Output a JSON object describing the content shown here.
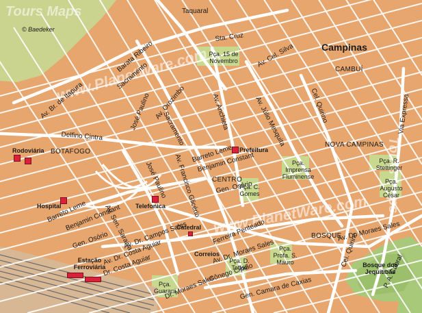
{
  "map": {
    "city": "Campinas",
    "credit": "© Baedeker",
    "watermarks": [
      "Tours Maps",
      "www.PlanetWare.com",
      "www.PlanetWare.com",
      "Tours Maps"
    ],
    "colors": {
      "land": "#e8a66f",
      "block": "#e8a66f",
      "street": "#ffffff",
      "park": "#a9c97a",
      "plaza": "#c9d88f",
      "marker": "#d9213a",
      "railway": "#6a6a6a"
    },
    "districts": [
      "CAMBUÍ",
      "BOTAFOGO",
      "CENTRO",
      "NOVA CAMPINAS",
      "BOSQUE"
    ],
    "streets": [
      "Taquaral",
      "Sta. Cruz",
      "Av. Cel. Silva",
      "Barata Ribeiro",
      "Sacramento",
      "Av. Br. de Itapura",
      "José Paulino",
      "Av. Orozimbo",
      "Av. Anchieta",
      "Av. Júlio Mesquita",
      "Cel. Quirino",
      "Via Expressa",
      "Delfino Cintra",
      "Barreto Leme",
      "Sacramento",
      "Benjamin Constant",
      "Gen. Osório",
      "Av. Francisco Glicério",
      "José Paulino",
      "Barreto Leme",
      "Benjamin Constant",
      "Av. Sen. Saraiva",
      "Av. Dr. Campos Sales",
      "Gen. Osório",
      "Ferreira Penteado",
      "Av. Dr. Moraes Sales",
      "Av. Dr. Moraes Sales",
      "Av. Dr. Costa Aguiar",
      "Dr. Costa Aguiar",
      "Cônego Cipião",
      "Gen. Camara de Caxias",
      "Cel. Quirino",
      "P. A. Cabral",
      "Dr. Moraes Sales"
    ],
    "places": [
      "Pça. 15 de Novembro",
      "Pça. Imprensa Fluminense",
      "Pça. C. Gomes",
      "Pça. R. Stettinger",
      "Pça. Augusto César",
      "Pça. Profa. S. Mauro",
      "Pça. D. Toffoli",
      "Pça. Guarani",
      "Bosque dos Jequitibás"
    ],
    "pois": [
      "Prefeitura",
      "Rodoviária",
      "Hospital",
      "Telefonica",
      "Catedral",
      "Correios",
      "Estação Ferroviária"
    ]
  }
}
